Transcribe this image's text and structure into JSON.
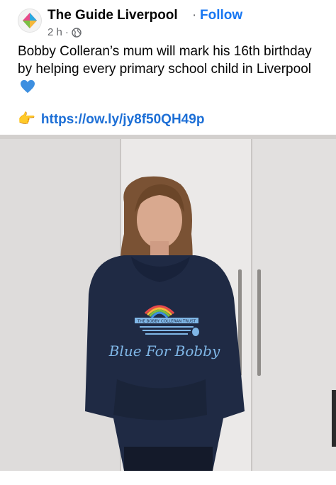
{
  "post": {
    "page_name": "The Guide Liverpool",
    "separator": "·",
    "follow_label": "Follow",
    "timestamp": "2 h",
    "meta_separator": "·",
    "text": "Bobby Colleran’s mum will mark his 16th birthday by helping every primary school child in Liverpool",
    "heart_icon": "blue-heart-icon",
    "pointer_icon": "pointing-hand-icon",
    "link": "https://ow.ly/jy8f50QH49p"
  },
  "photo": {
    "hoodie_text": "Blue For Bobby",
    "hoodie_banner": "THE BOBBY COLLERAN TRUST"
  },
  "colors": {
    "link": "#1d6fd6",
    "follow": "#1877f2",
    "hoodie": "#1f2a44",
    "print_blue": "#7fb6e6"
  }
}
